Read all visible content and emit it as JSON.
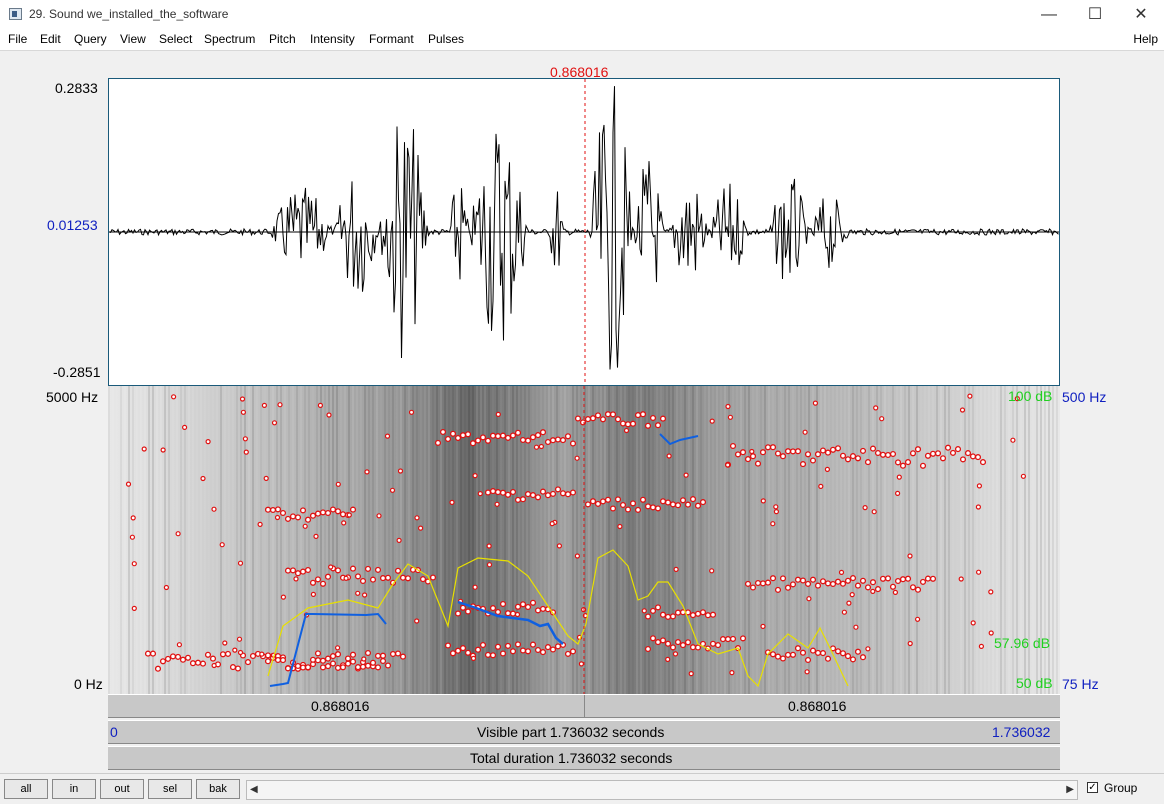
{
  "window": {
    "title": "29. Sound we_installed_the_software",
    "minimize": "—",
    "maximize": "☐",
    "close": "✕"
  },
  "menu": {
    "items": [
      "File",
      "Edit",
      "Query",
      "View",
      "Select",
      "Spectrum",
      "Pitch",
      "Intensity",
      "Formant",
      "Pulses"
    ],
    "help": "Help"
  },
  "waveform": {
    "max_label": "0.2833",
    "mid_label": "0.01253",
    "min_label": "-0.2851"
  },
  "cursor": {
    "time": "0.868016"
  },
  "spectrogram": {
    "freq_top": "5000 Hz",
    "freq_bottom": "0 Hz",
    "intensity_top": "100 dB",
    "intensity_current": "57.96 dB",
    "intensity_bottom": "50 dB",
    "pitch_top": "500 Hz",
    "pitch_bottom": "75 Hz"
  },
  "time_bars": {
    "left_segment": "0.868016",
    "right_segment": "0.868016",
    "visible_start": "0",
    "visible_text": "Visible part 1.736032 seconds",
    "visible_end": "1.736032",
    "total_text": "Total duration 1.736032 seconds"
  },
  "bottom": {
    "buttons": [
      "all",
      "in",
      "out",
      "sel",
      "bak"
    ],
    "group_label": "Group",
    "group_checked": true,
    "scroll_left": "◀",
    "scroll_right": "▶"
  },
  "colors": {
    "cursor": "#e01010",
    "axis_blue": "#1020c0",
    "intensity_green": "#20d020",
    "formant_red": "#e01010",
    "pitch_blue": "#1060e0",
    "intensity_yellow": "#e8e000"
  }
}
